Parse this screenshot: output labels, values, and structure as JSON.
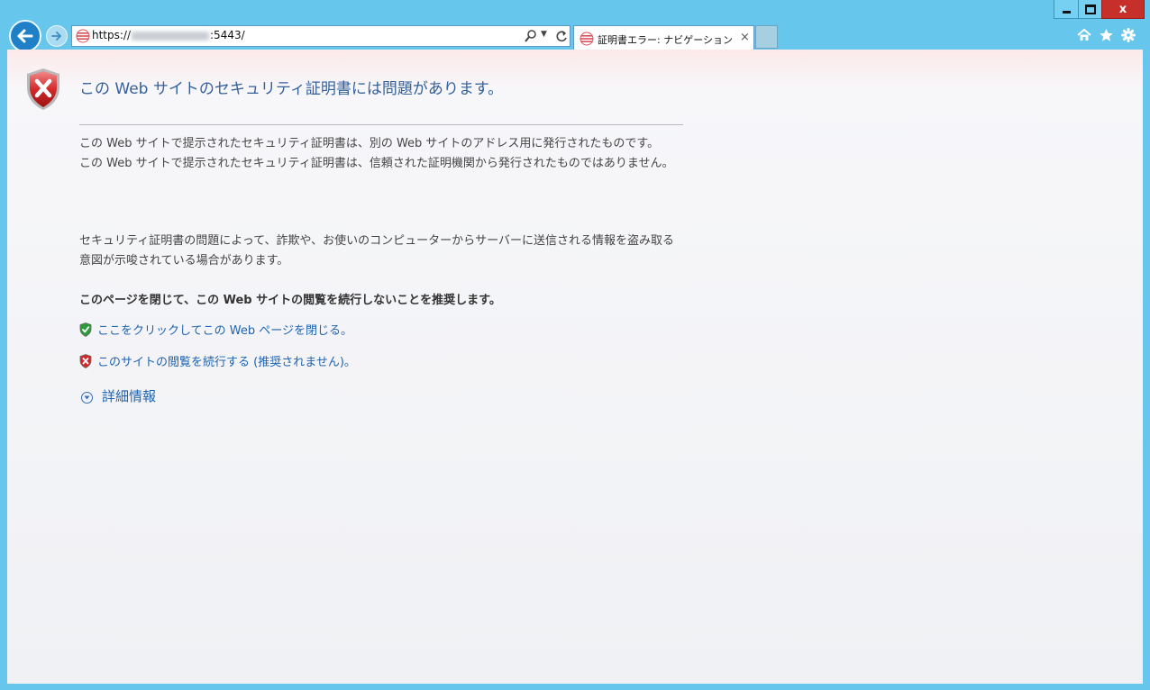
{
  "window": {
    "controls": {
      "minimize": "",
      "maximize": "",
      "close": "x"
    }
  },
  "address_bar": {
    "prefix": "https://",
    "suffix": ":5443/"
  },
  "tab": {
    "title": "証明書エラー: ナビゲーション...",
    "close": "×"
  },
  "page": {
    "title": "この Web サイトのセキュリティ証明書には問題があります。",
    "paragraph1": "この Web サイトで提示されたセキュリティ証明書は、別の Web サイトのアドレス用に発行されたものです。\nこの Web サイトで提示されたセキュリティ証明書は、信頼された証明機関から発行されたものではありません。",
    "paragraph2": "セキュリティ証明書の問題によって、詐欺や、お使いのコンピューターからサーバーに送信される情報を盗み取る意図が示唆されている場合があります。",
    "recommendation": "このページを閉じて、この Web サイトの閲覧を続行しないことを推奨します。",
    "close_link": "ここをクリックしてこの Web ページを閉じる。",
    "continue_link": "このサイトの閲覧を続行する (推奨されません)。",
    "more_info": "詳細情報"
  },
  "icons": {
    "back": "back-arrow-icon",
    "forward": "forward-arrow-icon",
    "favicon": "certificate-error-icon",
    "search": "search-icon",
    "refresh": "refresh-icon",
    "home": "home-icon",
    "favorites": "star-icon",
    "settings": "gear-icon",
    "error_shield": "red-shield-error-icon",
    "safe_shield": "green-shield-check-icon",
    "unsafe_shield": "red-shield-x-icon",
    "expand": "chevron-down-icon"
  },
  "colors": {
    "frame": "#66c6ec",
    "title": "#35619b",
    "link": "#1e63b0",
    "close_button": "#c7302a"
  }
}
